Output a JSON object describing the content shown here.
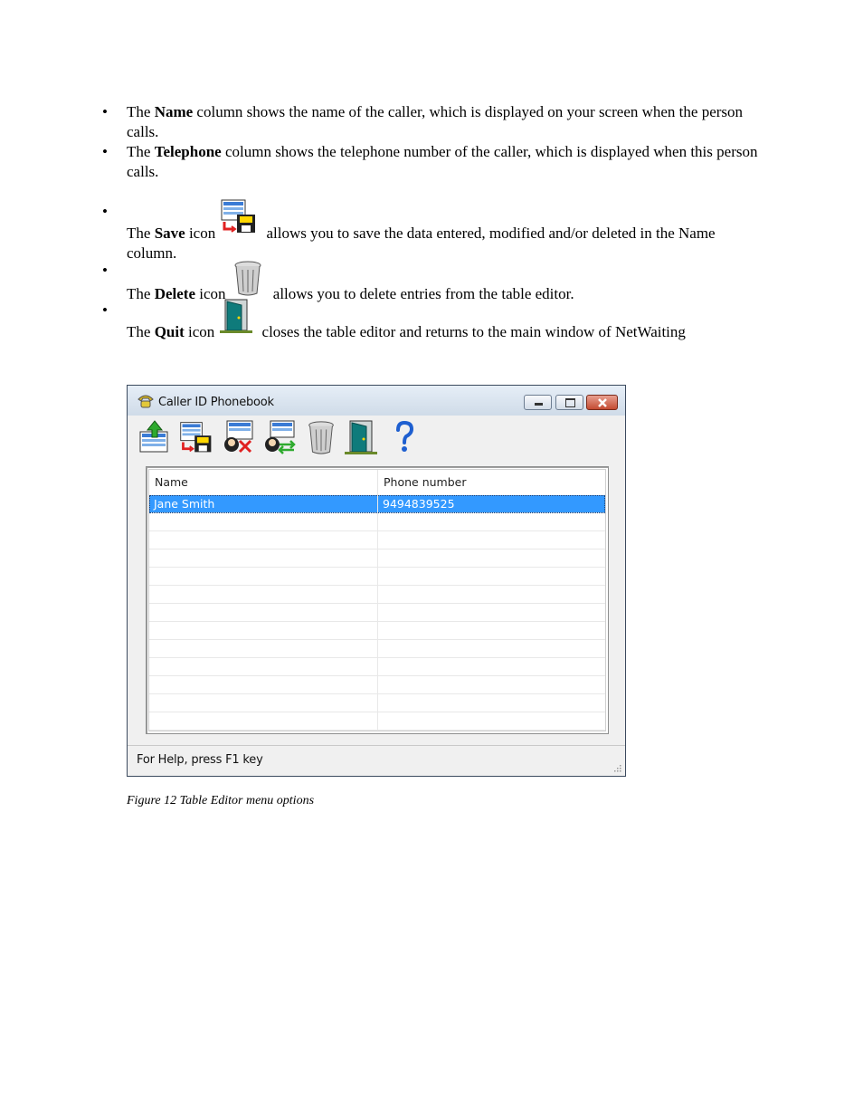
{
  "bullets": [
    {
      "pre": "The ",
      "bold": "Name",
      "post": " column shows the name of the caller, which is displayed on your screen when the person calls."
    },
    {
      "pre": "The ",
      "bold": "Telephone",
      "post": " column shows the telephone number of the caller, which is displayed when this person calls."
    },
    {
      "pre": "The ",
      "bold": "Save",
      "mid": " icon",
      "post": " allows you to save the data entered, modified and/or deleted in the Name column."
    },
    {
      "pre": "The ",
      "bold": "Delete",
      "mid": " icon",
      "post": " allows you to delete entries from the table editor."
    },
    {
      "pre": "The ",
      "bold": "Quit",
      "mid": " icon",
      "post": " closes the table editor and returns to the main window of NetWaiting"
    }
  ],
  "bullet_symbol": "•",
  "window": {
    "title": "Caller ID Phonebook",
    "toolbar_icons": [
      "import-icon",
      "save-icon",
      "delete-entry-icon",
      "transfer-icon",
      "trash-icon",
      "quit-door-icon",
      "help-icon"
    ],
    "columns": [
      "Name",
      "Phone number"
    ],
    "rows": [
      {
        "name": "Jane Smith",
        "phone": "9494839525",
        "selected": true
      }
    ],
    "empty_rows": 12,
    "status": "For Help, press F1 key",
    "selection_color": "#3399ff"
  },
  "caption": "Figure 12  Table Editor menu options"
}
